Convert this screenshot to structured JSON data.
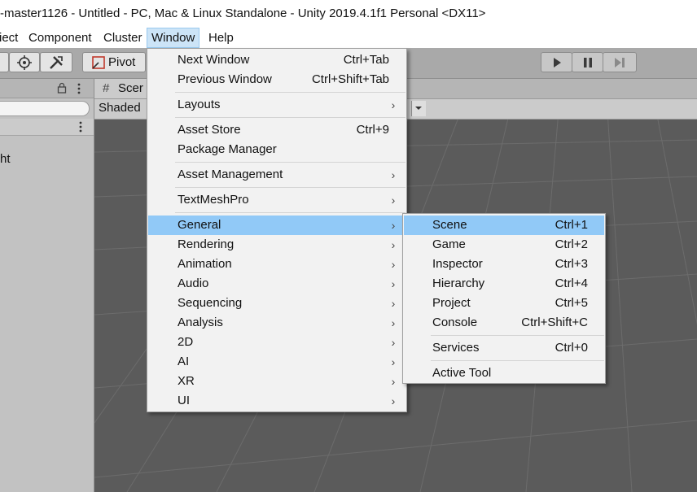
{
  "window_title": "-master1126 - Untitled - PC, Mac & Linux Standalone - Unity 2019.4.1f1 Personal <DX11>",
  "menubar": {
    "items": [
      "iect",
      "Component",
      "Cluster",
      "Window",
      "Help"
    ],
    "active": "Window"
  },
  "toolbar": {
    "pivot_label": "Pivot",
    "play_icon": "play-icon",
    "pause_icon": "pause-icon",
    "step_icon": "step-icon"
  },
  "left_panel": {
    "hierarchy_item": "ht"
  },
  "scene": {
    "tab_label": "Scer",
    "shading_mode": "Shaded"
  },
  "window_menu": {
    "items": [
      {
        "label": "Next Window",
        "shortcut": "Ctrl+Tab"
      },
      {
        "label": "Previous Window",
        "shortcut": "Ctrl+Shift+Tab"
      },
      {
        "label": "Layouts",
        "submenu": true
      },
      {
        "label": "Asset Store",
        "shortcut": "Ctrl+9"
      },
      {
        "label": "Package Manager"
      },
      {
        "label": "Asset Management",
        "submenu": true
      },
      {
        "label": "TextMeshPro",
        "submenu": true
      },
      {
        "label": "General",
        "submenu": true,
        "highlighted": true
      },
      {
        "label": "Rendering",
        "submenu": true
      },
      {
        "label": "Animation",
        "submenu": true
      },
      {
        "label": "Audio",
        "submenu": true
      },
      {
        "label": "Sequencing",
        "submenu": true
      },
      {
        "label": "Analysis",
        "submenu": true
      },
      {
        "label": "2D",
        "submenu": true
      },
      {
        "label": "AI",
        "submenu": true
      },
      {
        "label": "XR",
        "submenu": true
      },
      {
        "label": "UI",
        "submenu": true
      }
    ]
  },
  "general_submenu": {
    "items": [
      {
        "label": "Scene",
        "shortcut": "Ctrl+1",
        "highlighted": true
      },
      {
        "label": "Game",
        "shortcut": "Ctrl+2"
      },
      {
        "label": "Inspector",
        "shortcut": "Ctrl+3"
      },
      {
        "label": "Hierarchy",
        "shortcut": "Ctrl+4"
      },
      {
        "label": "Project",
        "shortcut": "Ctrl+5"
      },
      {
        "label": "Console",
        "shortcut": "Ctrl+Shift+C"
      },
      {
        "label": "Services",
        "shortcut": "Ctrl+0"
      },
      {
        "label": "Active Tool"
      }
    ]
  },
  "colors": {
    "menu_highlight": "#91c9f7",
    "menubar_active": "#cce4f7",
    "scene_background": "#5b5b5b"
  }
}
